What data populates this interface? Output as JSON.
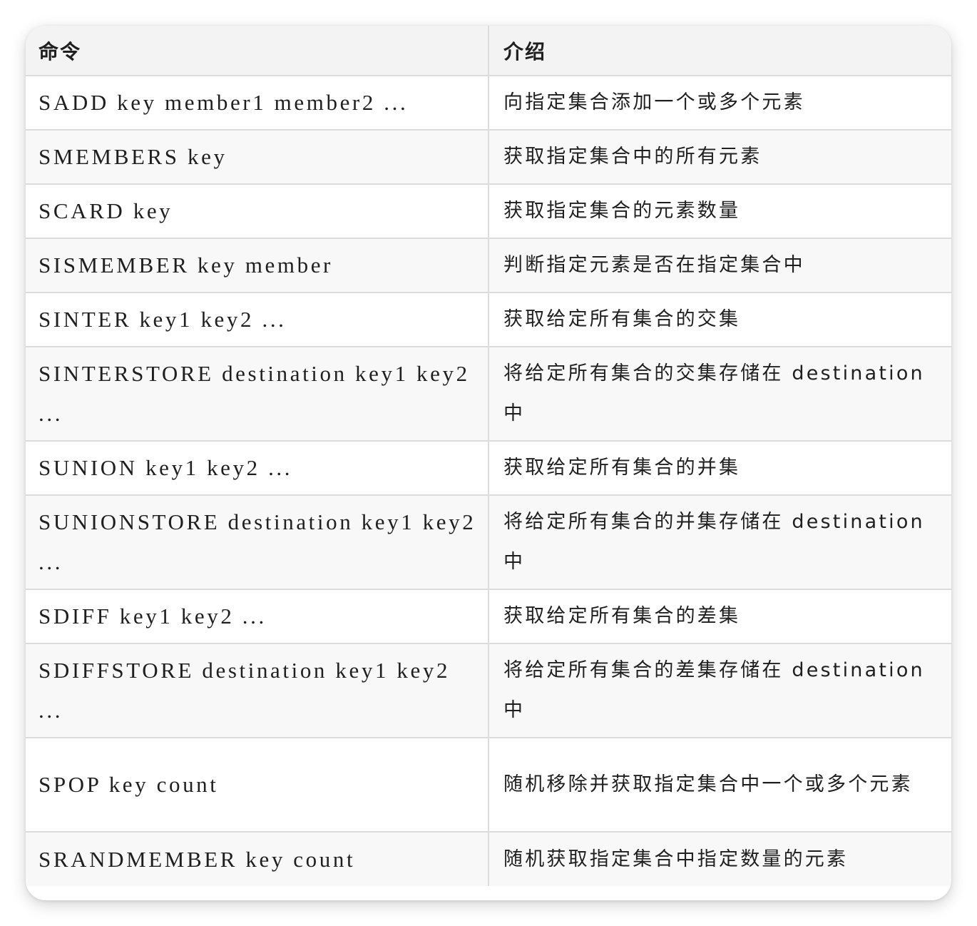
{
  "table": {
    "headers": {
      "command": "命令",
      "description": "介绍"
    },
    "rows": [
      {
        "command": "SADD key member1 member2 ...",
        "description": "向指定集合添加一个或多个元素"
      },
      {
        "command": "SMEMBERS key",
        "description": "获取指定集合中的所有元素"
      },
      {
        "command": "SCARD key",
        "description": "获取指定集合的元素数量"
      },
      {
        "command": "SISMEMBER key member",
        "description": "判断指定元素是否在指定集合中"
      },
      {
        "command": "SINTER key1 key2 ...",
        "description": "获取给定所有集合的交集"
      },
      {
        "command": "SINTERSTORE destination key1 key2 ...",
        "description": "将给定所有集合的交集存储在 destination 中"
      },
      {
        "command": "SUNION key1 key2 ...",
        "description": "获取给定所有集合的并集"
      },
      {
        "command": "SUNIONSTORE destination key1 key2 ...",
        "description": "将给定所有集合的并集存储在 destination 中"
      },
      {
        "command": "SDIFF key1 key2 ...",
        "description": "获取给定所有集合的差集"
      },
      {
        "command": "SDIFFSTORE destination key1 key2 ...",
        "description": "将给定所有集合的差集存储在 destination 中"
      },
      {
        "command": "SPOP key count",
        "description": "随机移除并获取指定集合中一个或多个元素"
      },
      {
        "command": "SRANDMEMBER key count",
        "description": "随机获取指定集合中指定数量的元素"
      }
    ]
  }
}
